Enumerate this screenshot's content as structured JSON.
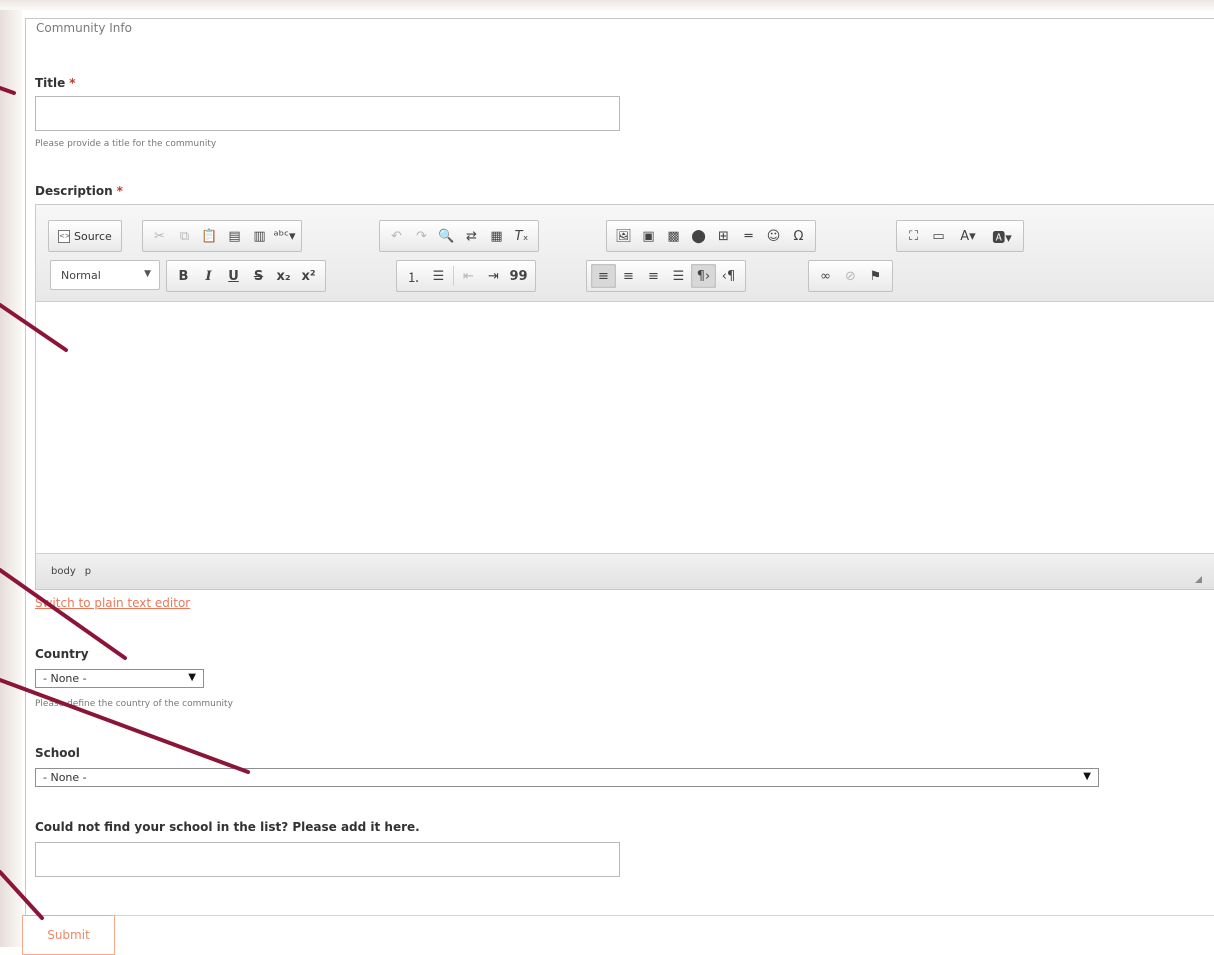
{
  "legend": "Community Info",
  "title_field": {
    "label": "Title",
    "required_mark": "*",
    "value": "",
    "hint": "Please provide a title for the community"
  },
  "description_field": {
    "label": "Description",
    "required_mark": "*",
    "toolbar": {
      "source_label": "Source",
      "format_combo": "Normal",
      "row1_icons": [
        "cut-icon",
        "copy-icon",
        "paste-icon",
        "paste-text-icon",
        "paste-word-icon",
        "spellcheck-icon",
        "undo-icon",
        "redo-icon",
        "find-icon",
        "replace-icon",
        "select-all-icon",
        "remove-format-icon",
        "image-icon",
        "flash-icon",
        "media-icon",
        "iframe-icon",
        "table-icon",
        "horizontal-rule-icon",
        "smiley-icon",
        "special-char-icon",
        "maximize-icon",
        "show-blocks-icon",
        "text-color-icon",
        "background-color-icon"
      ],
      "row2_icons": [
        "bold-icon",
        "italic-icon",
        "underline-icon",
        "strike-icon",
        "subscript-icon",
        "superscript-icon",
        "numbered-list-icon",
        "bulleted-list-icon",
        "outdent-icon",
        "indent-icon",
        "blockquote-icon",
        "align-left-icon",
        "align-center-icon",
        "align-right-icon",
        "justify-icon",
        "ltr-icon",
        "rtl-icon",
        "link-icon",
        "unlink-icon",
        "anchor-icon"
      ]
    },
    "path_items": [
      "body",
      "p"
    ]
  },
  "switch_link": "Switch to plain text editor",
  "country_field": {
    "label": "Country",
    "selected": "- None -",
    "hint": "Please define the country of the community"
  },
  "school_field": {
    "label": "School",
    "selected": "- None -"
  },
  "add_school_field": {
    "label": "Could not find your school in the list? Please add it here.",
    "value": ""
  },
  "submit_label": "Submit",
  "colors": {
    "link": "#e9775a",
    "required": "#c0392b",
    "annotation": "#8b1538",
    "submit_border": "#f3a98a"
  }
}
